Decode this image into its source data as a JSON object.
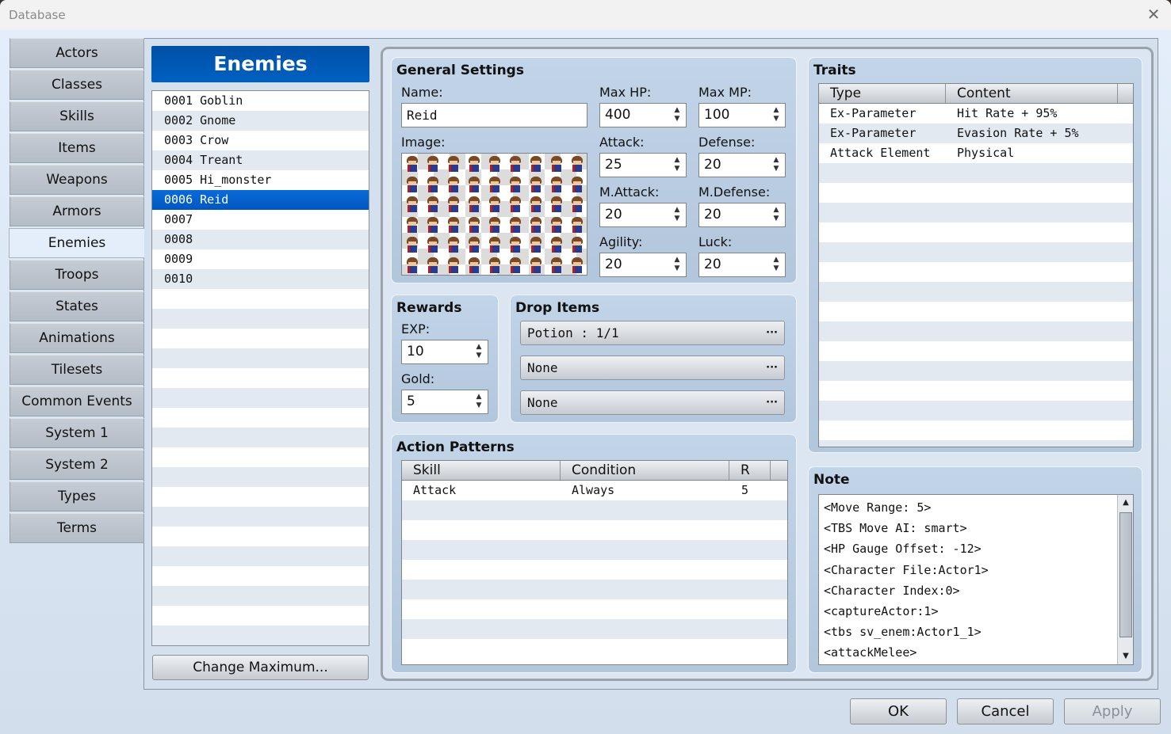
{
  "window": {
    "title": "Database",
    "close_icon": "close-icon"
  },
  "sidebar": {
    "active": "Enemies",
    "items": [
      {
        "label": "Actors"
      },
      {
        "label": "Classes"
      },
      {
        "label": "Skills"
      },
      {
        "label": "Items"
      },
      {
        "label": "Weapons"
      },
      {
        "label": "Armors"
      },
      {
        "label": "Enemies"
      },
      {
        "label": "Troops"
      },
      {
        "label": "States"
      },
      {
        "label": "Animations"
      },
      {
        "label": "Tilesets"
      },
      {
        "label": "Common Events"
      },
      {
        "label": "System 1"
      },
      {
        "label": "System 2"
      },
      {
        "label": "Types"
      },
      {
        "label": "Terms"
      }
    ]
  },
  "enemy_list": {
    "header": "Enemies",
    "selected_id": "0006",
    "items": [
      {
        "id": "0001",
        "name": "Goblin"
      },
      {
        "id": "0002",
        "name": "Gnome"
      },
      {
        "id": "0003",
        "name": "Crow"
      },
      {
        "id": "0004",
        "name": "Treant"
      },
      {
        "id": "0005",
        "name": "Hi_monster"
      },
      {
        "id": "0006",
        "name": "Reid"
      },
      {
        "id": "0007",
        "name": ""
      },
      {
        "id": "0008",
        "name": ""
      },
      {
        "id": "0009",
        "name": ""
      },
      {
        "id": "0010",
        "name": ""
      }
    ],
    "change_maximum_label": "Change Maximum..."
  },
  "general_settings": {
    "title": "General Settings",
    "name_label": "Name:",
    "name_value": "Reid",
    "image_label": "Image:",
    "stats": [
      {
        "key": "max_hp",
        "label": "Max HP:",
        "value": "400"
      },
      {
        "key": "max_mp",
        "label": "Max MP:",
        "value": "100"
      },
      {
        "key": "attack",
        "label": "Attack:",
        "value": "25"
      },
      {
        "key": "defense",
        "label": "Defense:",
        "value": "20"
      },
      {
        "key": "m_attack",
        "label": "M.Attack:",
        "value": "20"
      },
      {
        "key": "m_defense",
        "label": "M.Defense:",
        "value": "20"
      },
      {
        "key": "agility",
        "label": "Agility:",
        "value": "20"
      },
      {
        "key": "luck",
        "label": "Luck:",
        "value": "20"
      }
    ]
  },
  "rewards": {
    "title": "Rewards",
    "exp_label": "EXP:",
    "exp_value": "10",
    "gold_label": "Gold:",
    "gold_value": "5"
  },
  "drop_items": {
    "title": "Drop Items",
    "items": [
      {
        "label": "Potion : 1/1"
      },
      {
        "label": "None"
      },
      {
        "label": "None"
      }
    ],
    "more_glyph": "···"
  },
  "action_patterns": {
    "title": "Action Patterns",
    "columns": [
      "Skill",
      "Condition",
      "R"
    ],
    "rows": [
      {
        "skill": "Attack",
        "condition": "Always",
        "r": "5"
      }
    ]
  },
  "traits": {
    "title": "Traits",
    "columns": [
      "Type",
      "Content"
    ],
    "rows": [
      {
        "type": "Ex-Parameter",
        "content": "Hit Rate + 95%"
      },
      {
        "type": "Ex-Parameter",
        "content": "Evasion Rate + 5%"
      },
      {
        "type": "Attack Element",
        "content": "Physical"
      }
    ]
  },
  "note": {
    "title": "Note",
    "lines": [
      "<Move Range: 5>",
      "<TBS Move AI: smart>",
      "<HP Gauge Offset: -12>",
      "<Character File:Actor1>",
      "<Character Index:0>",
      "<captureActor:1>",
      "<tbs sv_enem:Actor1_1>",
      "<attackMelee>"
    ]
  },
  "footer": {
    "ok_label": "OK",
    "cancel_label": "Cancel",
    "apply_label": "Apply"
  },
  "icons": {
    "spin_up": "▲",
    "spin_down": "▼",
    "close": "✕",
    "scroll_up": "▲",
    "scroll_down": "▼"
  }
}
